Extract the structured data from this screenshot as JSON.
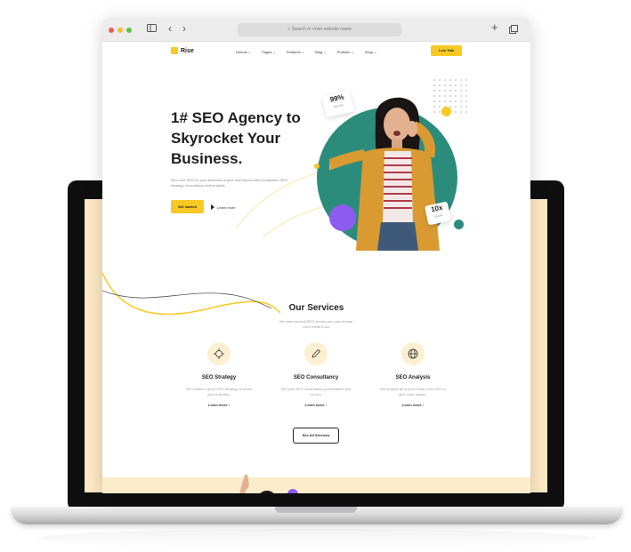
{
  "browser": {
    "address_placeholder": "Search or enter website name"
  },
  "site": {
    "logo": "Rise",
    "nav": [
      "Demos",
      "Pages",
      "Features",
      "Blog",
      "Portfolio",
      "Shop"
    ],
    "cta": "Lets Talk"
  },
  "hero": {
    "title_line1": "1# SEO Agency to",
    "title_highlight": "Skyrocket",
    "title_line2_rest": " Your",
    "title_line3": "Business.",
    "subtitle": "All in one SEO for your business to give new impact with handpicked SEO strategy, consultancy and analysis.",
    "primary_button": "Get started",
    "secondary_button": "Learn more",
    "badge1_value": "99%",
    "badge1_label": "Success",
    "badge2_value": "10x",
    "badge2_label": "Growth"
  },
  "services": {
    "title": "Our Services",
    "subtitle": "We have several SEO service you can choose. Let's check it out.",
    "cards": [
      {
        "icon": "crosshair-icon",
        "title": "SEO Strategy",
        "desc": "We crafted a great SEO Strategy to boost your business.",
        "link": "Learn more"
      },
      {
        "icon": "pen-icon",
        "title": "SEO Consultancy",
        "desc": "We build SEO consultancy personalized just for you.",
        "link": "Learn more"
      },
      {
        "icon": "globe-icon",
        "title": "SEO Analysis",
        "desc": "We analyze all of your touch point SEO to give more impact.",
        "link": "Learn more"
      }
    ],
    "all_button": "See All Services"
  },
  "colors": {
    "accent": "#f7c924",
    "teal": "#2c8c7c",
    "purple": "#8d5bf0"
  }
}
